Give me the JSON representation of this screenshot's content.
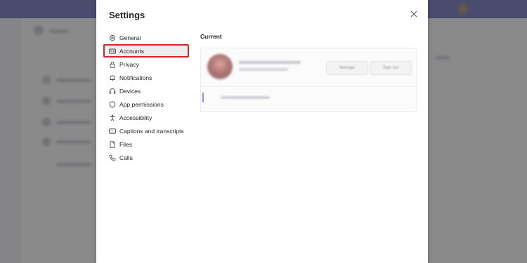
{
  "dialog": {
    "title": "Settings",
    "close_icon": "close-icon"
  },
  "nav": {
    "items": [
      {
        "label": "General",
        "icon": "gear-icon"
      },
      {
        "label": "Accounts",
        "icon": "id-card-icon",
        "selected": true
      },
      {
        "label": "Privacy",
        "icon": "lock-icon"
      },
      {
        "label": "Notifications",
        "icon": "bell-icon"
      },
      {
        "label": "Devices",
        "icon": "headset-icon"
      },
      {
        "label": "App permissions",
        "icon": "shield-icon"
      },
      {
        "label": "Accessibility",
        "icon": "accessibility-icon"
      },
      {
        "label": "Captions and transcripts",
        "icon": "cc-icon"
      },
      {
        "label": "Files",
        "icon": "file-icon"
      },
      {
        "label": "Calls",
        "icon": "phone-icon"
      }
    ]
  },
  "content": {
    "section_title": "Current",
    "account_card": {
      "manage_label": "Manage",
      "signout_label": "Sign out"
    }
  },
  "colors": {
    "highlight": "#d9242b",
    "accent": "#5b5fa8"
  }
}
